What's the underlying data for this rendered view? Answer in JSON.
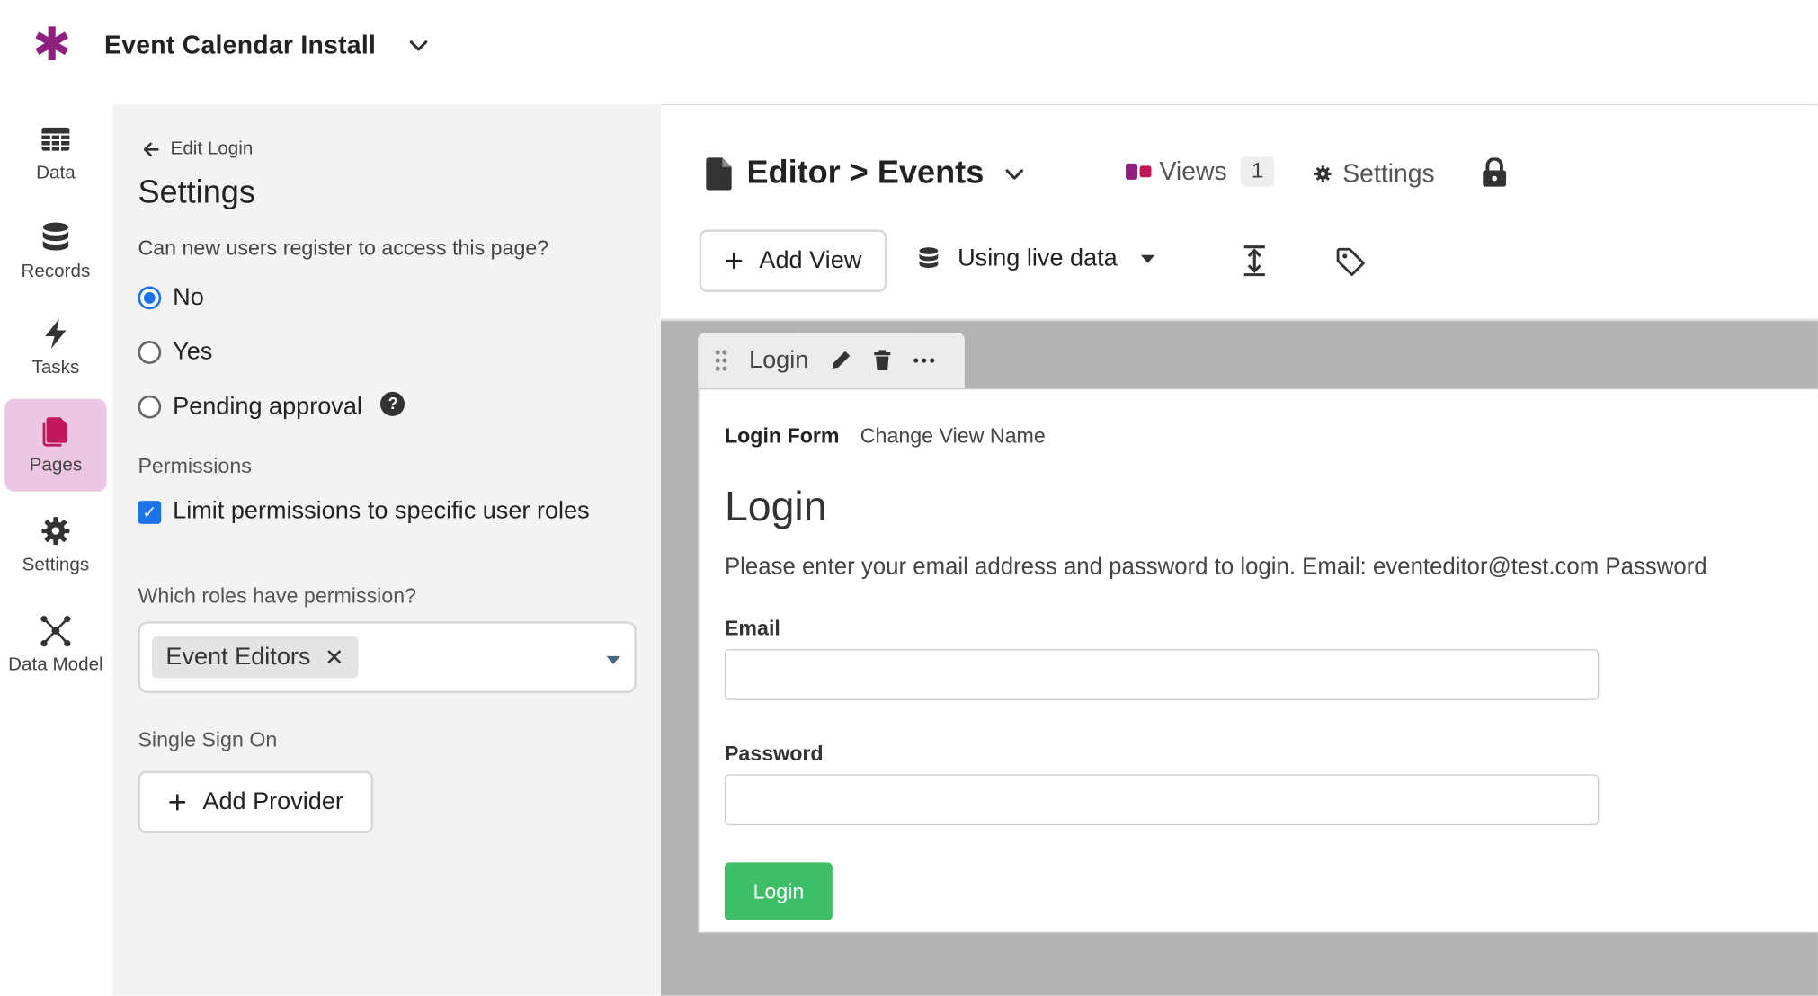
{
  "app": {
    "title": "Event Calendar Install"
  },
  "nav": {
    "items": [
      {
        "label": "Data"
      },
      {
        "label": "Records"
      },
      {
        "label": "Tasks"
      },
      {
        "label": "Pages"
      },
      {
        "label": "Settings"
      },
      {
        "label": "Data Model"
      }
    ],
    "active": "Pages",
    "active_color": "#ecc7e4"
  },
  "panel": {
    "back_label": "Edit Login",
    "title": "Settings",
    "register_question": "Can new users register to access this page?",
    "register_options": [
      "No",
      "Yes",
      "Pending approval"
    ],
    "register_selected": "No",
    "permissions_label": "Permissions",
    "limit_permissions_label": "Limit permissions to specific user roles",
    "limit_permissions_checked": true,
    "roles_question": "Which roles have permission?",
    "roles": [
      "Event Editors"
    ],
    "sso_label": "Single Sign On",
    "add_provider_label": "Add Provider"
  },
  "editor": {
    "page_name": "Editor > Events",
    "views_label": "Views",
    "views_count": "1",
    "settings_label": "Settings",
    "add_view_label": "Add View",
    "data_source_label": "Using live data"
  },
  "view": {
    "tab_name": "Login",
    "form_tabs": [
      "Login Form",
      "Change View Name"
    ],
    "heading": "Login",
    "description": "Please enter your email address and password to login. Email: eventeditor@test.com Password",
    "email_label": "Email",
    "email_value": "",
    "password_label": "Password",
    "password_value": "",
    "submit_label": "Login",
    "submit_color": "#3fbe68"
  },
  "colors": {
    "brand": "#8e1f7f",
    "accent": "#1a73e8"
  }
}
